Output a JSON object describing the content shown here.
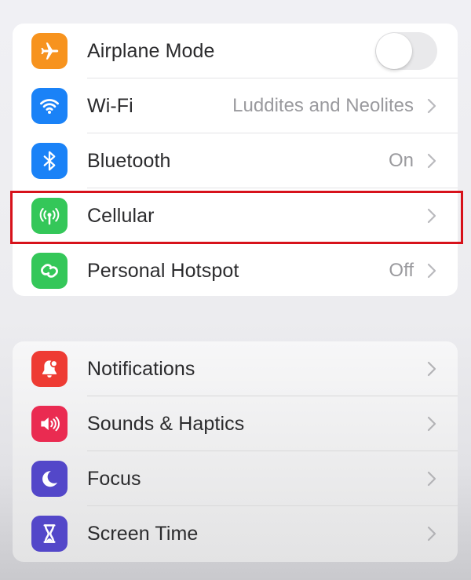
{
  "sections": [
    {
      "id": "connectivity",
      "items": [
        {
          "label": "Airplane Mode",
          "icon": "airplane-icon",
          "icon_color": "#f7931e",
          "control": "toggle",
          "toggle_on": false
        },
        {
          "label": "Wi-Fi",
          "icon": "wifi-icon",
          "icon_color": "#1a82f7",
          "detail": "Luddites and Neolites",
          "control": "chevron"
        },
        {
          "label": "Bluetooth",
          "icon": "bluetooth-icon",
          "icon_color": "#1a82f7",
          "detail": "On",
          "control": "chevron"
        },
        {
          "label": "Cellular",
          "icon": "cellular-antenna-icon",
          "icon_color": "#34c759",
          "control": "chevron",
          "highlighted": true
        },
        {
          "label": "Personal Hotspot",
          "icon": "hotspot-link-icon",
          "icon_color": "#34c759",
          "detail": "Off",
          "control": "chevron"
        }
      ]
    },
    {
      "id": "system",
      "items": [
        {
          "label": "Notifications",
          "icon": "bell-icon",
          "icon_color": "#ee3b33",
          "control": "chevron"
        },
        {
          "label": "Sounds & Haptics",
          "icon": "speaker-icon",
          "icon_color": "#ea2b51",
          "control": "chevron"
        },
        {
          "label": "Focus",
          "icon": "moon-icon",
          "icon_color": "#5347c9",
          "control": "chevron"
        },
        {
          "label": "Screen Time",
          "icon": "hourglass-icon",
          "icon_color": "#5347c9",
          "control": "chevron"
        }
      ]
    }
  ],
  "highlight_color": "#d7121b"
}
